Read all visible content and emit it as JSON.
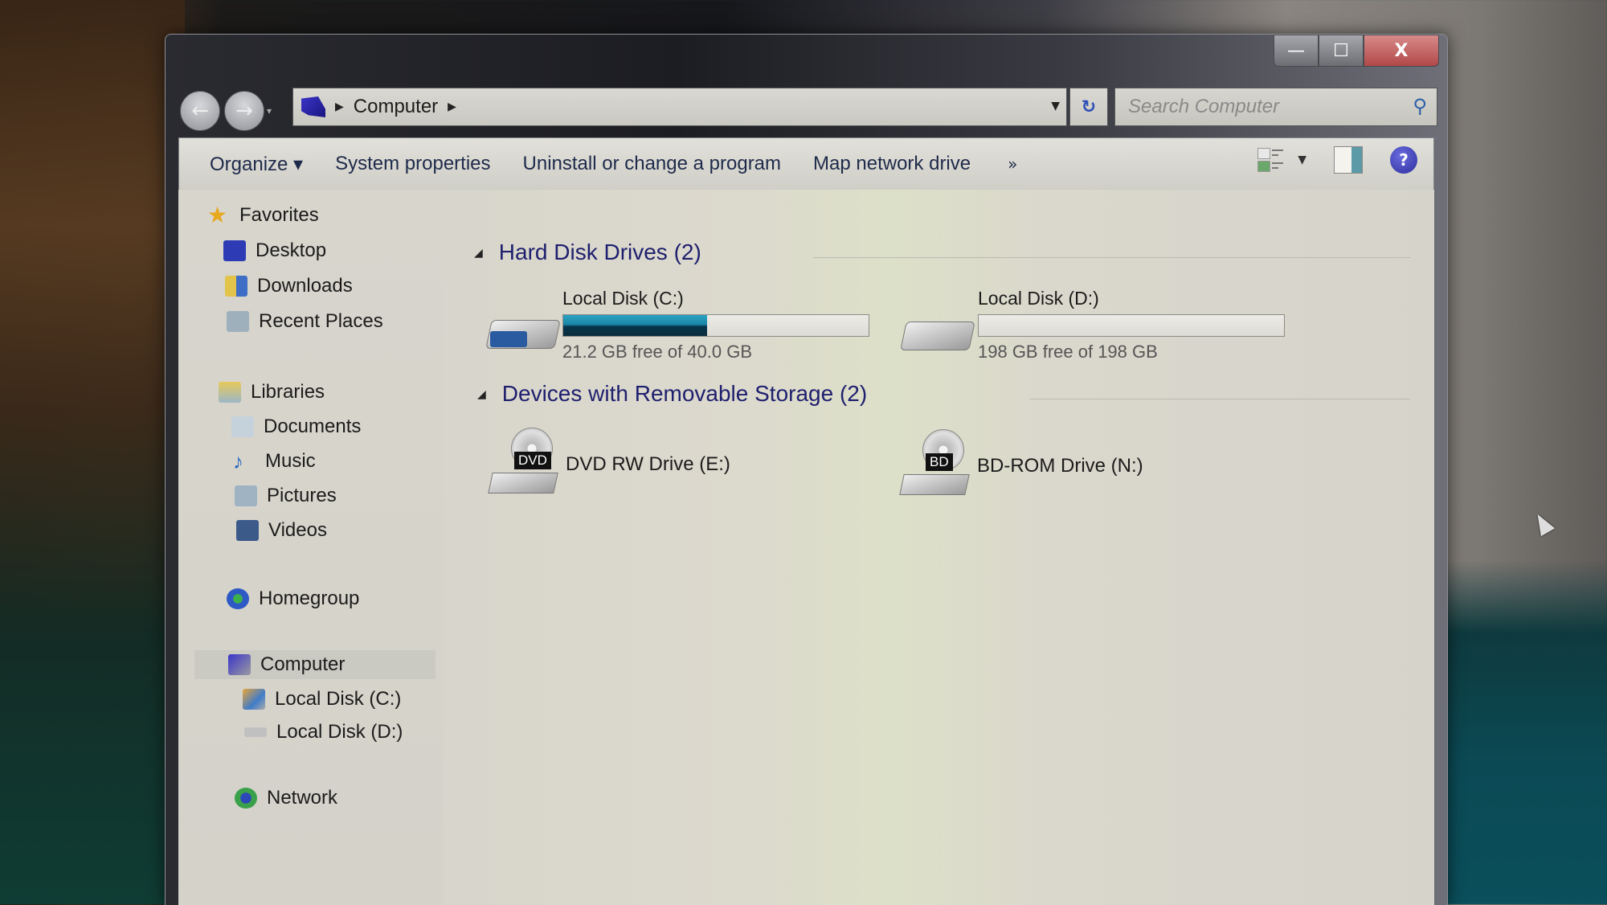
{
  "window": {
    "caption_buttons": {
      "minimize": "—",
      "maximize": "☐",
      "close": "X"
    }
  },
  "navbar": {
    "back_icon": "←",
    "forward_icon": "→",
    "history_icon": "▾",
    "breadcrumb": [
      "Computer"
    ],
    "separator": "▶",
    "address_dropdown_icon": "▼",
    "refresh_icon": "↻",
    "search_placeholder": "Search Computer",
    "search_icon": "⚲"
  },
  "toolbar": {
    "items": [
      "Organize ▾",
      "System properties",
      "Uninstall or change a program",
      "Map network drive"
    ],
    "more": "»",
    "view_dropdown": "▼",
    "help": "?"
  },
  "sidebar": {
    "favorites": {
      "label": "Favorites",
      "items": [
        "Desktop",
        "Downloads",
        "Recent Places"
      ]
    },
    "libraries": {
      "label": "Libraries",
      "items": [
        "Documents",
        "Music",
        "Pictures",
        "Videos"
      ]
    },
    "homegroup": {
      "label": "Homegroup"
    },
    "computer": {
      "label": "Computer",
      "items": [
        "Local Disk (C:)",
        "Local Disk (D:)"
      ]
    },
    "network": {
      "label": "Network"
    }
  },
  "main": {
    "groups": [
      {
        "title": "Hard Disk Drives (2)",
        "collapse_icon": "◢",
        "drives": [
          {
            "name": "Local Disk (C:)",
            "free_text": "21.2 GB free of 40.0 GB",
            "used_fraction": 0.47
          },
          {
            "name": "Local Disk (D:)",
            "free_text": "198 GB free of 198 GB",
            "used_fraction": 0.0
          }
        ]
      },
      {
        "title": "Devices with Removable Storage (2)",
        "collapse_icon": "◢",
        "devices": [
          {
            "name": "DVD RW Drive (E:)",
            "badge": "DVD"
          },
          {
            "name": "BD-ROM Drive (N:)",
            "badge": "BD"
          }
        ]
      }
    ]
  },
  "colors": {
    "usage_bar": "#1b86a6",
    "group_header": "#1e1f6e",
    "close_button": "#b24848"
  }
}
